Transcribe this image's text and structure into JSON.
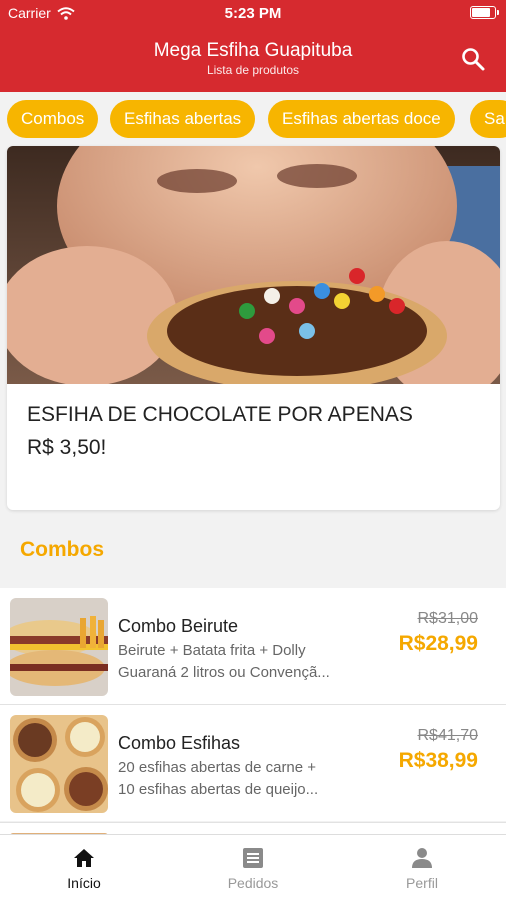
{
  "status_bar": {
    "carrier": "Carrier",
    "time": "5:23 PM"
  },
  "header": {
    "title": "Mega Esfiha Guapituba",
    "subtitle": "Lista de produtos",
    "search_icon": "search-icon"
  },
  "categories": [
    "Combos",
    "Esfihas abertas",
    "Esfihas abertas doce",
    "Sa"
  ],
  "banner": {
    "line1": "ESFIHA DE CHOCOLATE POR APENAS",
    "line2": "R$ 3,50!"
  },
  "section": {
    "title": "Combos"
  },
  "products": [
    {
      "name": "Combo Beirute",
      "desc1": "Beirute + Batata frita + Dolly",
      "desc2": "Guaraná 2 litros ou Convençã...",
      "old_price": "R$31,00",
      "price": "R$28,99"
    },
    {
      "name": "Combo Esfihas",
      "desc1": "20 esfihas abertas de carne +",
      "desc2": "10 esfihas abertas de queijo...",
      "old_price": "R$41,70",
      "price": "R$38,99"
    }
  ],
  "tabs": [
    {
      "label": "Início",
      "icon": "home-icon"
    },
    {
      "label": "Pedidos",
      "icon": "list-icon"
    },
    {
      "label": "Perfil",
      "icon": "person-icon"
    }
  ],
  "colors": {
    "header": "#d62a2f",
    "accent": "#f7b500",
    "price": "#f5a800"
  }
}
